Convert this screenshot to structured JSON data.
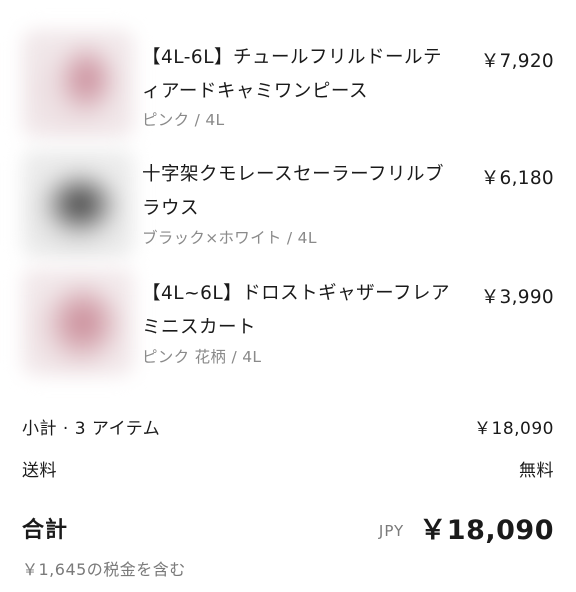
{
  "items": [
    {
      "title_line1": "【4L-6L】チュールフリルドールテ",
      "title_line2": "ィアードキャミワンピース",
      "variant": "ピンク / 4L",
      "price": "￥7,920"
    },
    {
      "title_line1": "十字架クモレースセーラーフリルブ",
      "title_line2": "ラウス",
      "variant": "ブラック×ホワイト / 4L",
      "price": "￥6,180"
    },
    {
      "title_line1": "【4L~6L】ドロストギャザーフレア",
      "title_line2": "ミニスカート",
      "variant": "ピンク 花柄 / 4L",
      "price": "￥3,990"
    }
  ],
  "summary": {
    "subtotal_label": "小計 · 3 アイテム",
    "subtotal_value": "￥18,090",
    "shipping_label": "送料",
    "shipping_value": "無料"
  },
  "total": {
    "label": "合計",
    "currency": "JPY",
    "amount": "￥18,090",
    "tax_note": "￥1,645の税金を含む"
  }
}
